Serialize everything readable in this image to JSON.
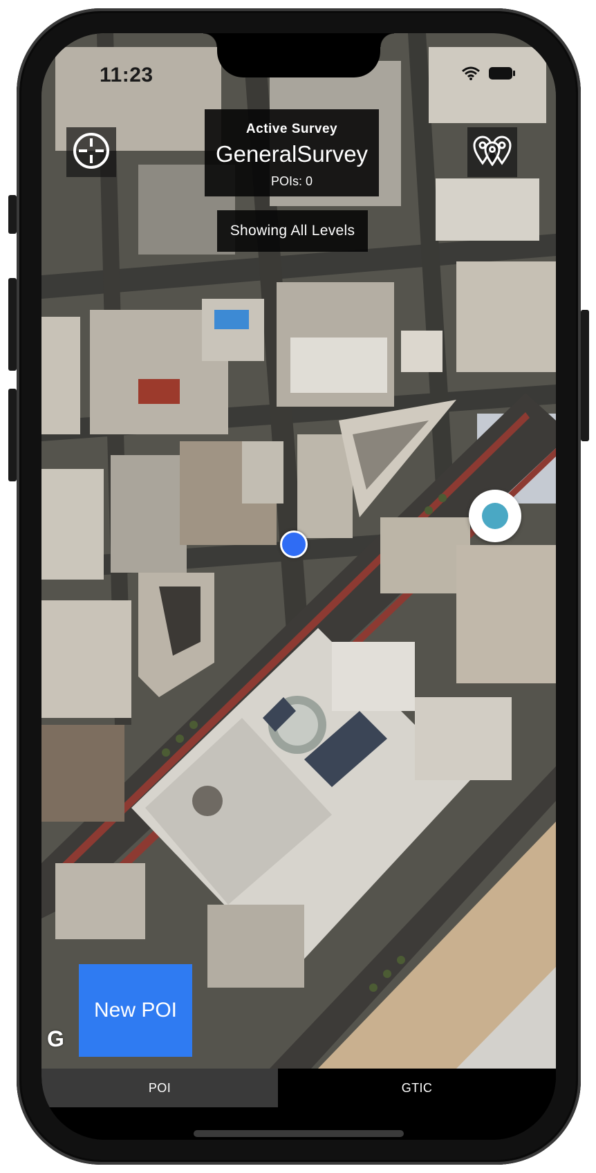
{
  "status_bar": {
    "time": "11:23",
    "wifi_icon": "wifi-icon",
    "battery_icon": "battery-icon"
  },
  "survey_panel": {
    "heading": "Active Survey",
    "name": "GeneralSurvey",
    "poi_count": "POIs: 0"
  },
  "levels": {
    "label": "Showing All Levels"
  },
  "toolbar": {
    "locate_icon": "crosshair-icon",
    "pois_icon": "map-pins-icon"
  },
  "map": {
    "attribution": "G"
  },
  "new_poi": {
    "label": "New POI"
  },
  "tabs": [
    {
      "label": "POI",
      "active": true
    },
    {
      "label": "GTIC",
      "active": false
    }
  ],
  "colors": {
    "accent_blue": "#2f7bf2",
    "location_dot": "#2f6cf4",
    "marker_teal": "#4aa8c4",
    "overlay_bg": "#080808"
  }
}
